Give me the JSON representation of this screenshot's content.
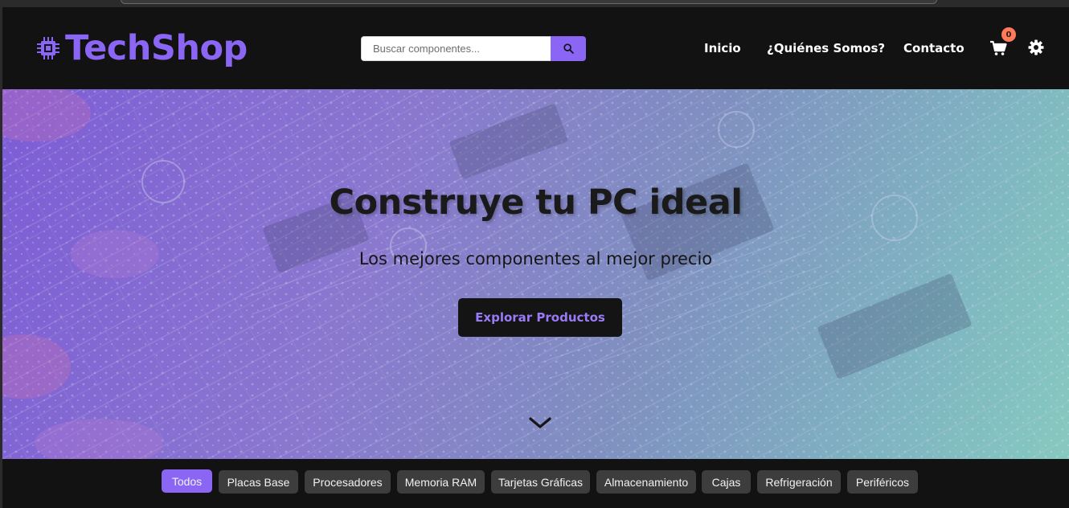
{
  "brand": {
    "name": "TechShop",
    "color": "#8b66f5"
  },
  "search": {
    "placeholder": "Buscar componentes...",
    "icon": "search-icon"
  },
  "nav": {
    "items": [
      {
        "label": "Inicio"
      },
      {
        "label": "¿Quiénes Somos?"
      },
      {
        "label": "Contacto"
      }
    ],
    "cart_count": "0",
    "cart_icon": "cart-icon",
    "theme_icon": "gear-icon"
  },
  "hero": {
    "title": "Construye tu PC ideal",
    "subtitle": "Los mejores componentes al mejor precio",
    "cta_label": "Explorar Productos",
    "scroll_icon": "chevron-down-icon"
  },
  "categories": {
    "active": "Todos",
    "items": [
      {
        "label": "Todos"
      },
      {
        "label": "Placas Base"
      },
      {
        "label": "Procesadores"
      },
      {
        "label": "Memoria RAM"
      },
      {
        "label": "Tarjetas Gráficas"
      },
      {
        "label": "Almacenamiento"
      },
      {
        "label": "Cajas"
      },
      {
        "label": "Refrigeración"
      },
      {
        "label": "Periféricos"
      }
    ]
  },
  "colors": {
    "accent": "#8b66f5",
    "header_bg": "#121212",
    "badge": "#ff7a59",
    "chip_bg": "#3d3d3d"
  }
}
